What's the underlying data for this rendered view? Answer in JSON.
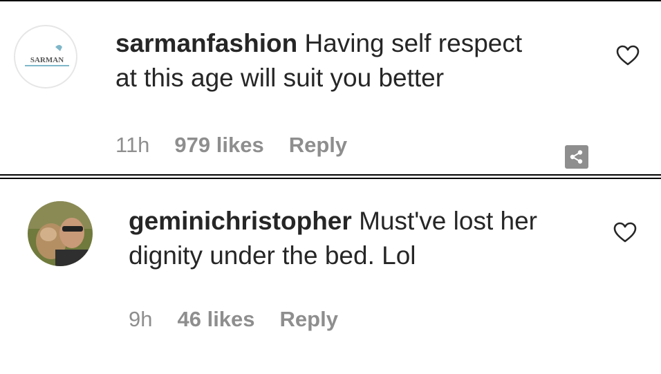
{
  "comments": [
    {
      "username": "sarmanfashion",
      "text": "Having self respect",
      "text_line2": "at this age will suit you better",
      "time": "11h",
      "likes": "979 likes",
      "reply": "Reply",
      "avatar_logo": "SARMAN"
    },
    {
      "username": "geminichristopher",
      "text": "Must've lost her",
      "text_line2": "dignity under the bed. Lol",
      "time": "9h",
      "likes": "46 likes",
      "reply": "Reply"
    }
  ],
  "icons": {
    "like": "heart-icon",
    "share": "share-icon"
  },
  "colors": {
    "text": "#262626",
    "meta": "#8e8e8e",
    "share_bg": "#8e8e8e"
  }
}
